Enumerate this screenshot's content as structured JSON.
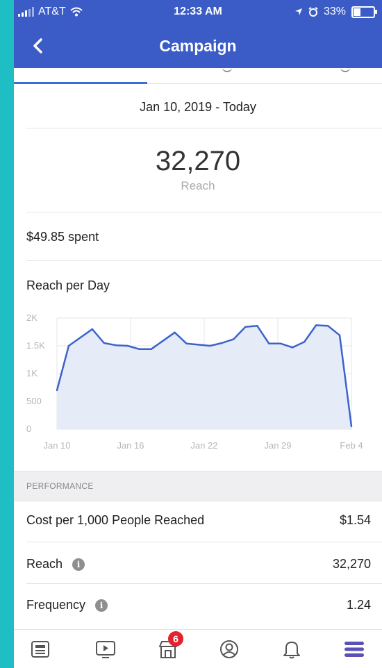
{
  "status": {
    "carrier": "AT&T",
    "time": "12:33 AM",
    "battery": "33%"
  },
  "nav": {
    "title": "Campaign"
  },
  "date_range": "Jan 10, 2019 - Today",
  "reach_total": {
    "value": "32,270",
    "label": "Reach"
  },
  "spent": "$49.85 spent",
  "chart_title": "Reach per Day",
  "chart_data": {
    "type": "area",
    "x_tick_labels": [
      "Jan 10",
      "Jan 16",
      "Jan 22",
      "Jan 29",
      "Feb 4"
    ],
    "y_tick_labels": [
      "2K",
      "1.5K",
      "1K",
      "500",
      "0"
    ],
    "ylim": [
      0,
      2000
    ],
    "x": [
      "Jan 10",
      "Jan 11",
      "Jan 12",
      "Jan 13",
      "Jan 14",
      "Jan 15",
      "Jan 16",
      "Jan 17",
      "Jan 18",
      "Jan 19",
      "Jan 20",
      "Jan 21",
      "Jan 22",
      "Jan 23",
      "Jan 24",
      "Jan 25",
      "Jan 26",
      "Jan 27",
      "Jan 28",
      "Jan 29",
      "Jan 30",
      "Jan 31",
      "Feb 1",
      "Feb 2",
      "Feb 3",
      "Feb 4"
    ],
    "values": [
      700,
      1500,
      1650,
      1800,
      1550,
      1510,
      1500,
      1440,
      1440,
      1590,
      1740,
      1540,
      1520,
      1500,
      1550,
      1620,
      1840,
      1860,
      1540,
      1540,
      1470,
      1570,
      1870,
      1860,
      1690,
      50
    ],
    "grid": true,
    "color": "#3b63cc",
    "fill": "#e6ebf8"
  },
  "performance": {
    "header": "PERFORMANCE",
    "rows": [
      {
        "label": "Cost per 1,000 People Reached",
        "value": "$1.54"
      },
      {
        "label": "Reach",
        "value": "32,270"
      },
      {
        "label": "Frequency",
        "value": "1.24"
      }
    ]
  },
  "tabbar": {
    "items": [
      "news-feed-icon",
      "watch-icon",
      "marketplace-icon",
      "profile-icon",
      "notifications-icon",
      "menu-icon"
    ],
    "marketplace_badge": "6"
  },
  "colors": {
    "nav": "#3b5cc6",
    "accent": "#3b6fd6",
    "badge": "#e4222d",
    "menu_active": "#5b50b8"
  }
}
